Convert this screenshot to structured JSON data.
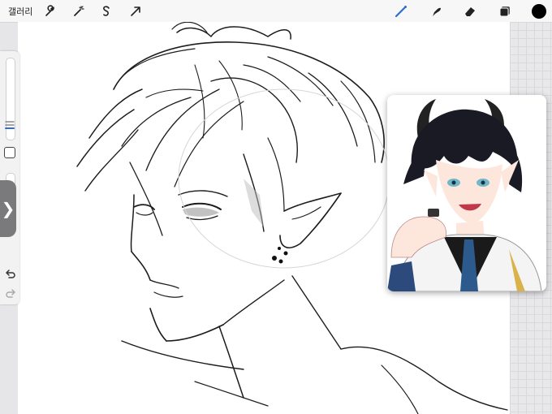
{
  "toolbar": {
    "gallery_label": "갤러리",
    "left_tools": [
      "wrench-icon",
      "magic-wand-icon",
      "selection-icon",
      "transform-arrow-icon"
    ],
    "right_tools": [
      "brush-icon",
      "smudge-icon",
      "eraser-icon",
      "layers-icon"
    ],
    "active_tool": "brush-icon",
    "active_color": "#000000",
    "accent": "#2e6bd6"
  },
  "sidebar": {
    "brush_size_level": 0.85,
    "opacity_level": 0.9,
    "controls": [
      "brush-size-slider",
      "modify-button",
      "opacity-slider",
      "undo-icon",
      "redo-icon"
    ]
  },
  "reference": {
    "visible": true
  }
}
